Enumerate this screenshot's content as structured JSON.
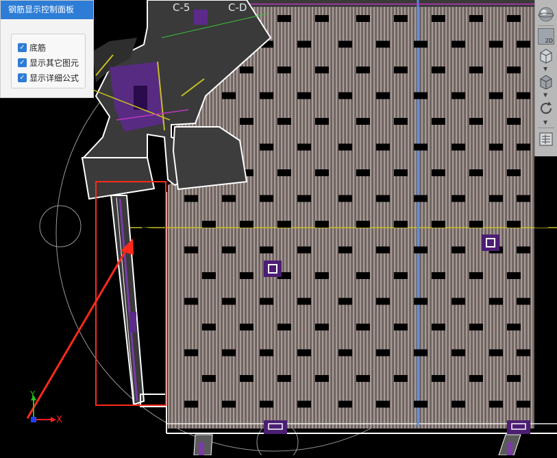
{
  "panel": {
    "title": "钢筋显示控制面板",
    "options": [
      {
        "label": "底筋",
        "checked": true
      },
      {
        "label": "显示其它图元",
        "checked": true
      },
      {
        "label": "显示详细公式",
        "checked": true
      }
    ]
  },
  "axis_labels": {
    "c5": "C-5",
    "cd": "C-D",
    "y": "Y",
    "x": "X"
  },
  "toolbar": {
    "view_2d_label": "2D",
    "icons": [
      "orbit-sphere-icon",
      "view-2d-icon",
      "view-3d-box-icon",
      "view-3d-cube-icon",
      "rotate-icon",
      "layer-panel-icon"
    ]
  },
  "colors": {
    "panel_header": "#2d7cd6",
    "annotation": "#ff2a1a",
    "axis_yellow": "#c8c020",
    "axis_blue": "#5a8ede",
    "purple": "#6a2f9e"
  }
}
